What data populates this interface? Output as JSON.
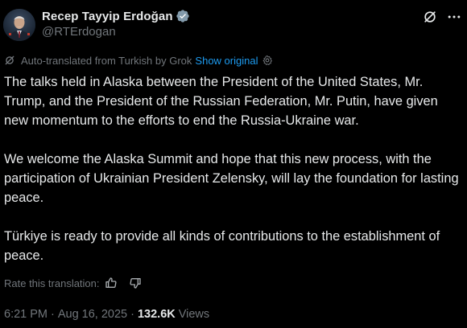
{
  "author": {
    "display_name": "Recep Tayyip Erdoğan",
    "handle": "@RTErdogan",
    "verified": true,
    "verified_badge_color": "#829aab"
  },
  "header_actions": {
    "grok_icon": "grok-icon",
    "more_icon": "more-dots-icon"
  },
  "translation": {
    "notice": "Auto-translated from Turkish by Grok",
    "show_original_label": "Show original",
    "link_color": "#1d9bf0"
  },
  "tweet": {
    "paragraphs": [
      "The talks held in Alaska between the President of the United States, Mr. Trump, and the President of the Russian Federation, Mr. Putin, have given new momentum to the efforts to end the Russia-Ukraine war.",
      "We welcome the Alaska Summit and hope that this new process, with the participation of Ukrainian President Zelensky, will lay the foundation for lasting peace.",
      "Türkiye is ready to provide all kinds of contributions to the establishment of peace."
    ]
  },
  "rating": {
    "label": "Rate this translation:"
  },
  "meta": {
    "time": "6:21 PM",
    "separator": "·",
    "date": "Aug 16, 2025",
    "views_count": "132.6K",
    "views_label": "Views"
  }
}
